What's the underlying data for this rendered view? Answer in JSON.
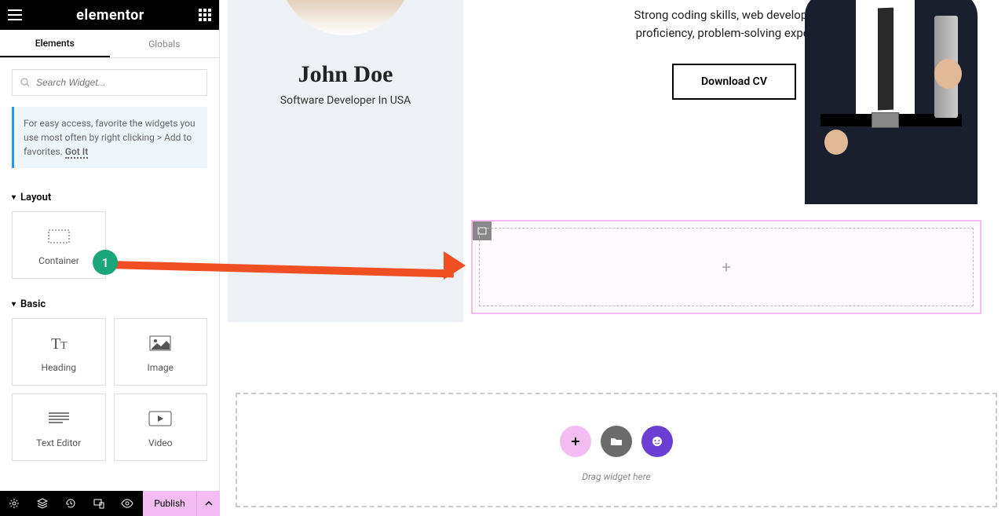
{
  "header": {
    "logo": "elementor"
  },
  "tabs": {
    "elements": "Elements",
    "globals": "Globals"
  },
  "search": {
    "placeholder": "Search Widget..."
  },
  "tip": {
    "text": "For easy access, favorite the widgets you use most often by right clicking > Add to favorites.",
    "got_it": "Got It"
  },
  "sections": {
    "layout": "Layout",
    "basic": "Basic"
  },
  "widgets": {
    "container": "Container",
    "heading": "Heading",
    "image": "Image",
    "text_editor": "Text Editor",
    "video": "Video"
  },
  "footer": {
    "publish": "Publish"
  },
  "profile": {
    "name": "John Doe",
    "role": "Software Developer In USA"
  },
  "hero": {
    "skills_line1": "Strong coding skills, web development",
    "skills_line2": "proficiency, problem-solving expertise",
    "download": "Download CV"
  },
  "drop": {
    "hint": "Drag widget here"
  },
  "annotation": {
    "step": "1"
  }
}
